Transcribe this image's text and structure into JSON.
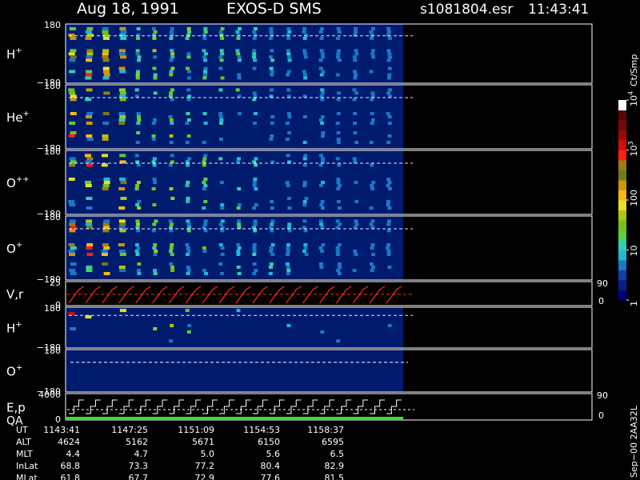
{
  "header": {
    "date": "Aug 18, 1991",
    "instrument": "EXOS-D SMS",
    "file": "s1081804.esr",
    "time": "11:43:41"
  },
  "colors": {
    "background": "#000000",
    "panel_fill": "#001a6e",
    "axis": "#ffffff",
    "velocity_trace": "#ff2a1a",
    "qa_bar": "#3ddc3d"
  },
  "chart_data": {
    "type": "heatmap",
    "panels": [
      {
        "id": "h-plus",
        "label_main": "H",
        "label_sup": "+",
        "ytop": "180",
        "ybot": "−180",
        "intensity": "high"
      },
      {
        "id": "he-plus",
        "label_main": "He",
        "label_sup": "+",
        "ytop": "180",
        "ybot": "−180",
        "intensity": "medium"
      },
      {
        "id": "o-pp",
        "label_main": "O",
        "label_sup": "++",
        "ytop": "180",
        "ybot": "−180",
        "intensity": "medium"
      },
      {
        "id": "o-plus",
        "label_main": "O",
        "label_sup": "+",
        "ytop": "180",
        "ybot": "−180",
        "intensity": "high"
      },
      {
        "id": "vr",
        "label_main": "V,r",
        "label_sup": "",
        "ytop": "25",
        "ybot": "0",
        "right_top": "90",
        "right_bot": "0"
      },
      {
        "id": "h-plus-2",
        "label_main": "H",
        "label_sup": "+",
        "ytop": "180",
        "ybot": "−180",
        "intensity": "sparse"
      },
      {
        "id": "o-plus-2",
        "label_main": "O",
        "label_sup": "+",
        "ytop": "180",
        "ybot": "−180",
        "intensity": "none"
      },
      {
        "id": "ep-qa",
        "label_main": "E,p",
        "label_sub": "QA",
        "ytop": "4000",
        "ybot": "0",
        "right_top": "90",
        "right_bot": "0"
      }
    ],
    "colorbar": {
      "title": "Ct/Smp",
      "ticks": [
        {
          "main": "10",
          "sup": "4",
          "value": 10000
        },
        {
          "main": "10",
          "sup": "3",
          "value": 1000
        },
        {
          "main": "100",
          "sup": "",
          "value": 100
        },
        {
          "main": "10",
          "sup": "",
          "value": 10
        },
        {
          "main": "1",
          "sup": "",
          "value": 1
        }
      ],
      "scale": "log",
      "range": [
        1,
        10000
      ],
      "colors": [
        "#000080",
        "#0a1a90",
        "#1040a8",
        "#1a78c8",
        "#20b8d8",
        "#2fd0b0",
        "#58d040",
        "#78c018",
        "#a8c818",
        "#e8e020",
        "#f8b818",
        "#c89808",
        "#787818",
        "#988010",
        "#ff2010",
        "#d01008",
        "#a00808",
        "#780808",
        "#580404",
        "#ffffff"
      ]
    },
    "time_axis": {
      "rows": [
        {
          "name": "UT",
          "values": [
            "1143:41",
            "1147:25",
            "1151:09",
            "1154:53",
            "1158:37"
          ]
        },
        {
          "name": "ALT",
          "values": [
            "4624",
            "5162",
            "5671",
            "6150",
            "6595"
          ]
        },
        {
          "name": "MLT",
          "values": [
            "4.4",
            "4.7",
            "5.0",
            "5.6",
            "6.5"
          ]
        },
        {
          "name": "InLat",
          "values": [
            "68.8",
            "73.3",
            "77.2",
            "80.4",
            "82.9"
          ]
        },
        {
          "name": "MLat",
          "values": [
            "61.8",
            "67.7",
            "72.9",
            "77.6",
            "81.5"
          ]
        }
      ]
    },
    "data_coverage_fraction": 0.5,
    "spin_columns": 20,
    "footer_note": "Sep−00 2AA32L"
  }
}
